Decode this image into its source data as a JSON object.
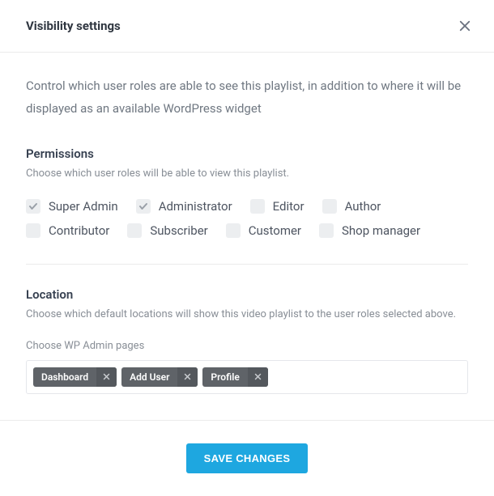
{
  "header": {
    "title": "Visibility settings"
  },
  "intro": "Control which user roles are able to see this playlist, in addition to where it will be displayed as an available WordPress widget",
  "permissions": {
    "title": "Permissions",
    "desc": "Choose which user roles will be able to view this playlist.",
    "roles": [
      {
        "label": "Super Admin",
        "checked": true
      },
      {
        "label": "Administrator",
        "checked": true
      },
      {
        "label": "Editor",
        "checked": false
      },
      {
        "label": "Author",
        "checked": false
      },
      {
        "label": "Contributor",
        "checked": false
      },
      {
        "label": "Subscriber",
        "checked": false
      },
      {
        "label": "Customer",
        "checked": false
      },
      {
        "label": "Shop manager",
        "checked": false
      }
    ]
  },
  "location": {
    "title": "Location",
    "desc": "Choose which default locations will show this video playlist to the user roles selected above.",
    "field_label": "Choose WP Admin pages",
    "tags": [
      {
        "label": "Dashboard"
      },
      {
        "label": "Add User"
      },
      {
        "label": "Profile"
      }
    ]
  },
  "footer": {
    "save_label": "SAVE CHANGES"
  }
}
